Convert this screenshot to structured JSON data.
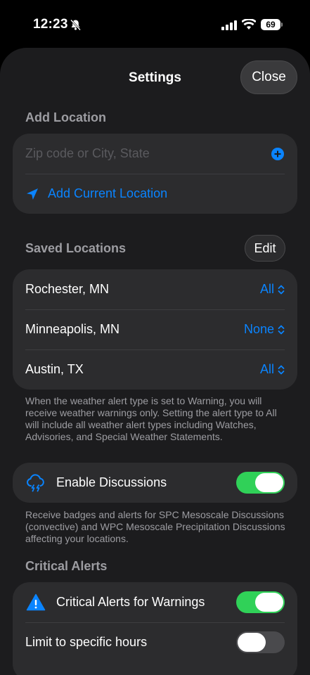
{
  "status_bar": {
    "time": "12:23",
    "battery": "69"
  },
  "sheet": {
    "title": "Settings",
    "close_label": "Close"
  },
  "add_location": {
    "header": "Add Location",
    "placeholder": "Zip code or City, State",
    "current_location_label": "Add Current Location"
  },
  "saved_locations": {
    "header": "Saved Locations",
    "edit_label": "Edit",
    "items": [
      {
        "name": "Rochester, MN",
        "alert_type": "All"
      },
      {
        "name": "Minneapolis, MN",
        "alert_type": "None"
      },
      {
        "name": "Austin, TX",
        "alert_type": "All"
      }
    ],
    "footnote": "When the weather alert type is set to Warning, you will receive weather warnings only. Setting the alert type to All will include all weather alert types including Watches, Advisories, and Special Weather Statements."
  },
  "discussions": {
    "label": "Enable Discussions",
    "enabled": true,
    "icon": "cloud-lightning-icon",
    "footnote": "Receive badges and alerts for SPC Mesoscale Discussions (convective) and WPC Mesoscale Precipitation Discussions affecting your locations."
  },
  "critical_alerts": {
    "header": "Critical Alerts",
    "warnings_label": "Critical Alerts for Warnings",
    "warnings_enabled": true,
    "warnings_icon": "warning-triangle-icon",
    "hours_label": "Limit to specific hours",
    "hours_enabled": false
  },
  "colors": {
    "accent": "#0a84ff",
    "toggle_on": "#30d158",
    "background": "#1c1c1e",
    "card": "#2c2c2e"
  }
}
